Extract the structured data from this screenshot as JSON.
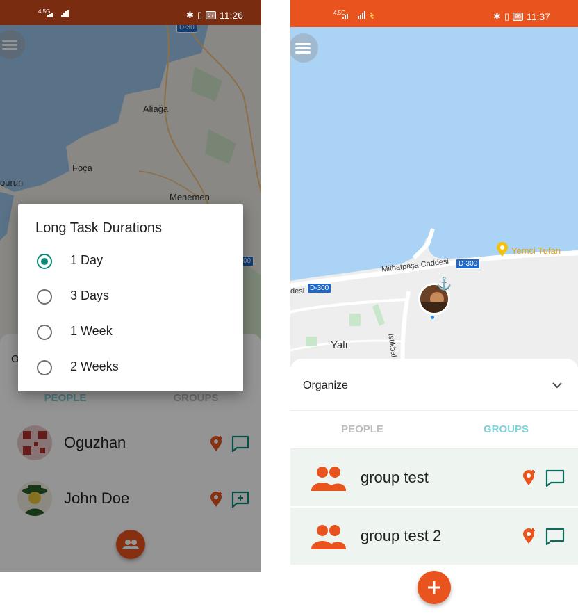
{
  "left_screen": {
    "status_bar": {
      "network": "4.5G",
      "battery": "97",
      "time": "11:26"
    },
    "map_labels": {
      "aliaga": "Aliağa",
      "foca": "Foça",
      "burun": "ourun",
      "menemen": "Menemen",
      "road_top": "D-30",
      "road_right": "00"
    },
    "tabs": {
      "people": "PEOPLE",
      "groups": "GROUPS"
    },
    "organize_fragment": "O",
    "people": [
      {
        "name": "Oguzhan"
      },
      {
        "name": "John Doe"
      }
    ],
    "dialog": {
      "title": "Long Task Durations",
      "options": [
        "1 Day",
        "3 Days",
        "1 Week",
        "2 Weeks"
      ],
      "selected": "1 Day"
    }
  },
  "right_screen": {
    "status_bar": {
      "network": "4.5G",
      "battery": "96",
      "time": "11:37"
    },
    "map_labels": {
      "poi": "Yemci Tufan",
      "street": "Mithatpaşa Caddesi",
      "road_badge_1": "D-300",
      "road_badge_2": "D-300",
      "street_left": "desi",
      "side_street": "İstikbal Cad",
      "district": "Yalı"
    },
    "organize": {
      "label": "Organize"
    },
    "tabs": {
      "people": "PEOPLE",
      "groups": "GROUPS",
      "active": "GROUPS"
    },
    "groups": [
      {
        "name": "group test"
      },
      {
        "name": "group test 2"
      }
    ]
  },
  "colors": {
    "accent": "#e9541e",
    "status_bar_dark": "#7a2c11",
    "teal": "#0e8a7a",
    "active_tab": "#7fd0d8",
    "water": "#aad3f5",
    "group_row_bg": "#eef5f1"
  }
}
